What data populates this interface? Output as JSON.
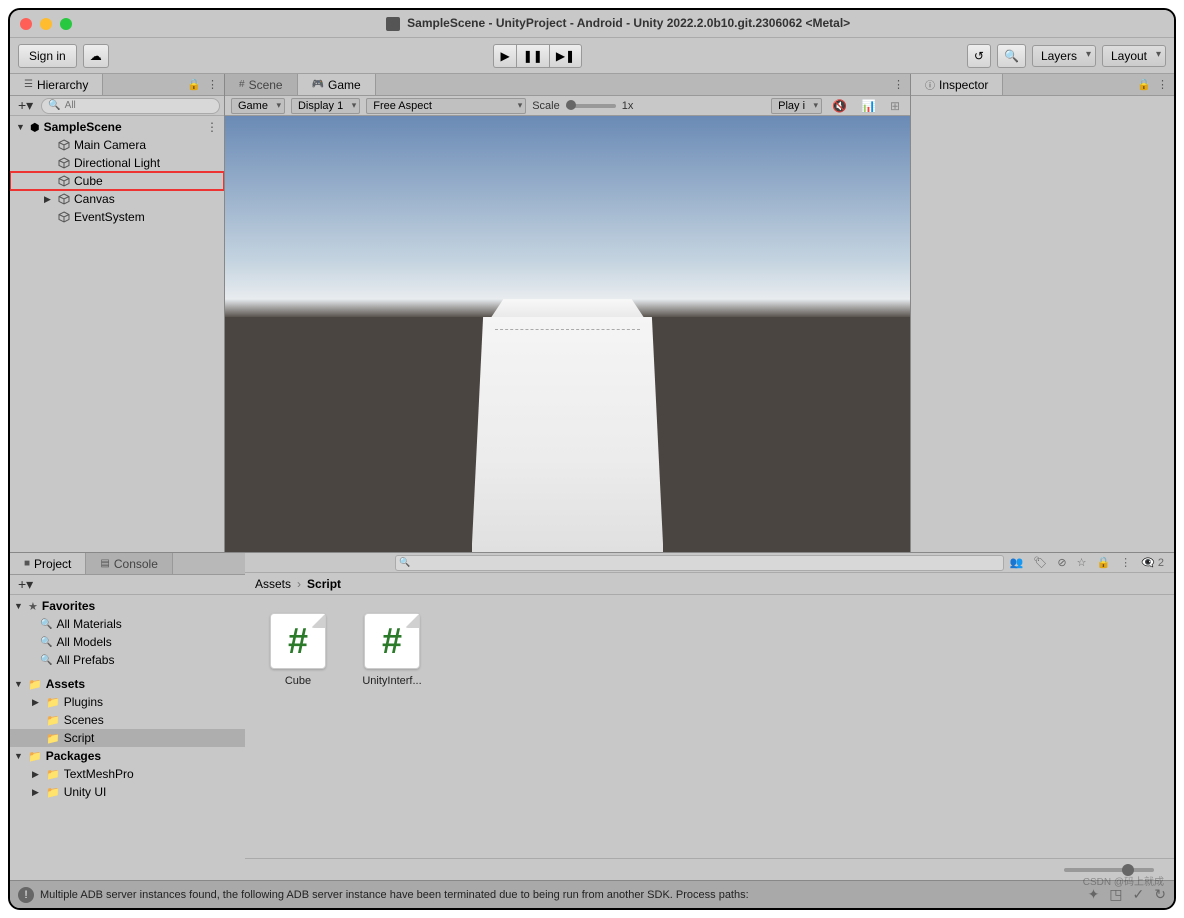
{
  "window": {
    "title": "SampleScene - UnityProject - Android - Unity 2022.2.0b10.git.2306062 <Metal>"
  },
  "toolbar": {
    "signin": "Sign in",
    "layers": "Layers",
    "layout": "Layout"
  },
  "hierarchy": {
    "title": "Hierarchy",
    "search_placeholder": "All",
    "scene": "SampleScene",
    "items": [
      {
        "name": "Main Camera",
        "indent": 2
      },
      {
        "name": "Directional Light",
        "indent": 2
      },
      {
        "name": "Cube",
        "indent": 2,
        "highlight": true
      },
      {
        "name": "Canvas",
        "indent": 2,
        "expandable": true
      },
      {
        "name": "EventSystem",
        "indent": 2
      }
    ]
  },
  "scene_tab": "Scene",
  "game_tab": "Game",
  "game_toolbar": {
    "mode": "Game",
    "display": "Display 1",
    "aspect": "Free Aspect",
    "scale_label": "Scale",
    "scale_value": "1x",
    "play": "Play i"
  },
  "inspector": {
    "title": "Inspector"
  },
  "project": {
    "title": "Project",
    "console": "Console",
    "hidden_count": "2",
    "favorites": "Favorites",
    "fav_items": [
      "All Materials",
      "All Models",
      "All Prefabs"
    ],
    "assets": "Assets",
    "asset_folders": [
      "Plugins",
      "Scenes",
      "Script"
    ],
    "packages": "Packages",
    "package_items": [
      "TextMeshPro",
      "Unity UI"
    ],
    "breadcrumb_root": "Assets",
    "breadcrumb_current": "Script",
    "grid": [
      {
        "label": "Cube"
      },
      {
        "label": "UnityInterf..."
      }
    ]
  },
  "status": {
    "message": "Multiple ADB server instances found, the following ADB server instance have been terminated due to being run from another SDK. Process paths:"
  },
  "watermark": "CSDN @码上就成"
}
